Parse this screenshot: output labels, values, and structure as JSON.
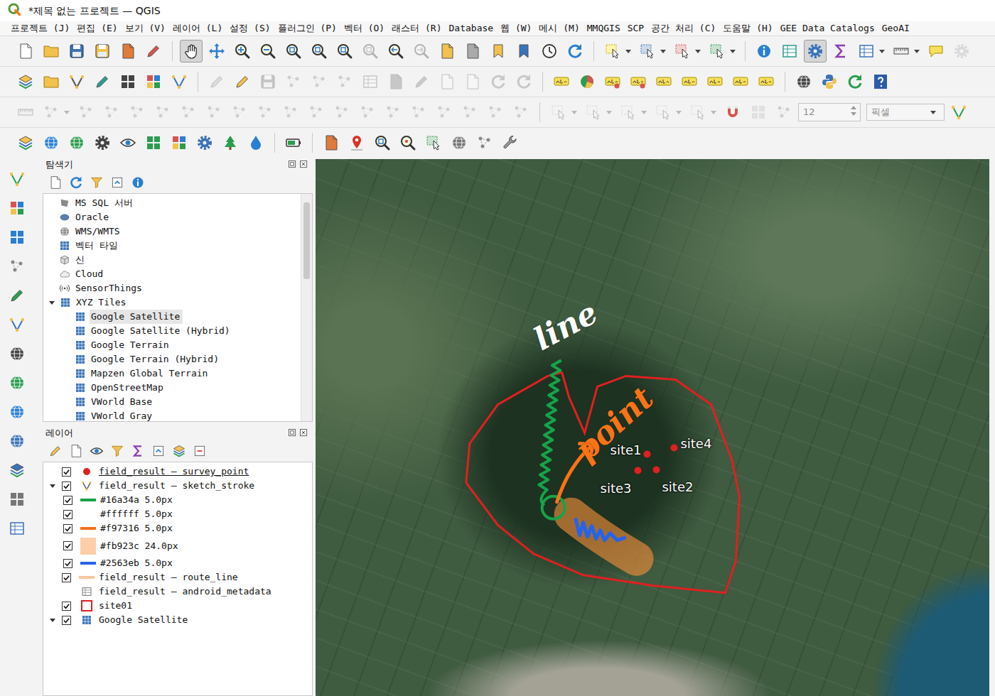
{
  "window": {
    "title": "*제목 없는 프로젝트 — QGIS"
  },
  "menu": [
    "프로젝트 (J)",
    "편집 (E)",
    "보기 (V)",
    "레이어 (L)",
    "설정 (S)",
    "플러그인 (P)",
    "벡터 (O)",
    "래스터 (R)",
    "Database",
    "웹 (W)",
    "메시 (M)",
    "MMQGIS",
    "SCP",
    "공간 처리 (C)",
    "도움말 (H)",
    "GEE Data Catalogs",
    "GeoAI"
  ],
  "toolbars": [
    {
      "tools": [
        {
          "selected": false,
          "disabled": false
        },
        {
          "selected": false,
          "disabled": false
        },
        {
          "selected": false,
          "disabled": false
        },
        {
          "selected": false,
          "disabled": false
        },
        {
          "selected": false,
          "disabled": false
        },
        {
          "selected": false,
          "disabled": false
        },
        {
          "selected": true,
          "disabled": false
        },
        {
          "selected": false,
          "disabled": false
        },
        {
          "selected": false,
          "disabled": false
        },
        {
          "selected": false,
          "disabled": false
        },
        {
          "selected": false,
          "disabled": false
        },
        {
          "selected": false,
          "disabled": false
        },
        {
          "selected": false,
          "disabled": false
        },
        {
          "selected": false,
          "disabled": true
        },
        {
          "selected": false,
          "disabled": false
        },
        {
          "selected": false,
          "disabled": true
        },
        {
          "selected": false,
          "disabled": false
        },
        {
          "selected": false,
          "disabled": false
        },
        {
          "selected": false,
          "disabled": false
        },
        {
          "selected": false,
          "disabled": false
        },
        {
          "selected": false,
          "disabled": false
        },
        {
          "selected": false,
          "disabled": false
        },
        {
          "selected": false,
          "disabled": false
        },
        {
          "selected": false,
          "disabled": false
        },
        {
          "selected": false,
          "disabled": false
        },
        {
          "selected": false,
          "disabled": false
        },
        {
          "selected": false,
          "disabled": false
        },
        {
          "selected": false,
          "disabled": false
        },
        {
          "selected": true,
          "disabled": false
        },
        {
          "selected": false,
          "disabled": false
        },
        {
          "selected": false,
          "disabled": false
        },
        {
          "selected": false,
          "disabled": false
        },
        {
          "selected": false,
          "disabled": false
        },
        {
          "selected": false,
          "disabled": true
        }
      ]
    },
    {
      "tools": [
        {
          "selected": false,
          "disabled": false
        },
        {
          "selected": false,
          "disabled": false
        },
        {
          "selected": false,
          "disabled": false
        },
        {
          "selected": false,
          "disabled": false
        },
        {
          "selected": false,
          "disabled": false
        },
        {
          "selected": false,
          "disabled": false
        },
        {
          "selected": false,
          "disabled": false
        },
        {
          "selected": false,
          "disabled": true
        },
        {
          "selected": false,
          "disabled": false
        },
        {
          "selected": false,
          "disabled": true
        },
        {
          "selected": false,
          "disabled": true
        },
        {
          "selected": false,
          "disabled": true
        },
        {
          "selected": false,
          "disabled": true
        },
        {
          "selected": false,
          "disabled": true
        },
        {
          "selected": false,
          "disabled": true
        },
        {
          "selected": false,
          "disabled": true
        },
        {
          "selected": false,
          "disabled": true
        },
        {
          "selected": false,
          "disabled": true
        },
        {
          "selected": false,
          "disabled": true
        },
        {
          "selected": false,
          "disabled": true
        },
        {
          "selected": false,
          "disabled": false
        },
        {
          "selected": false,
          "disabled": false
        },
        {
          "selected": false,
          "disabled": false
        },
        {
          "selected": false,
          "disabled": false
        },
        {
          "selected": false,
          "disabled": false
        },
        {
          "selected": false,
          "disabled": false
        },
        {
          "selected": false,
          "disabled": false
        },
        {
          "selected": false,
          "disabled": false
        },
        {
          "selected": false,
          "disabled": false
        },
        {
          "selected": false,
          "disabled": false
        },
        {
          "selected": false,
          "disabled": false
        },
        {
          "selected": false,
          "disabled": false
        },
        {
          "selected": false,
          "disabled": false
        }
      ]
    },
    {
      "tools": [
        {
          "selected": false,
          "disabled": true
        },
        {
          "selected": false,
          "disabled": true
        },
        {
          "selected": false,
          "disabled": true
        },
        {
          "selected": false,
          "disabled": true
        },
        {
          "selected": false,
          "disabled": true
        },
        {
          "selected": false,
          "disabled": true
        },
        {
          "selected": false,
          "disabled": true
        },
        {
          "selected": false,
          "disabled": true
        },
        {
          "selected": false,
          "disabled": true
        },
        {
          "selected": false,
          "disabled": true
        },
        {
          "selected": false,
          "disabled": true
        },
        {
          "selected": false,
          "disabled": true
        },
        {
          "selected": false,
          "disabled": true
        },
        {
          "selected": false,
          "disabled": true
        },
        {
          "selected": false,
          "disabled": true
        },
        {
          "selected": false,
          "disabled": true
        },
        {
          "selected": false,
          "disabled": true
        },
        {
          "selected": false,
          "disabled": true
        },
        {
          "selected": false,
          "disabled": true
        },
        {
          "selected": false,
          "disabled": true
        },
        {
          "selected": false,
          "disabled": true
        },
        {
          "selected": false,
          "disabled": true
        },
        {
          "selected": false,
          "disabled": true
        },
        {
          "selected": false,
          "disabled": true
        },
        {
          "selected": false,
          "disabled": true
        },
        {
          "selected": false,
          "disabled": false
        },
        {
          "selected": false,
          "disabled": true
        },
        {
          "selected": false,
          "disabled": true
        },
        {
          "selected": false,
          "disabled": false
        }
      ]
    },
    {
      "tools": [
        {
          "selected": false,
          "disabled": false
        },
        {
          "selected": false,
          "disabled": false
        },
        {
          "selected": false,
          "disabled": false
        },
        {
          "selected": false,
          "disabled": false
        },
        {
          "selected": false,
          "disabled": false
        },
        {
          "selected": false,
          "disabled": false
        },
        {
          "selected": false,
          "disabled": false
        },
        {
          "selected": false,
          "disabled": false
        },
        {
          "selected": false,
          "disabled": false
        },
        {
          "selected": false,
          "disabled": false
        },
        {
          "selected": false,
          "disabled": false
        },
        {
          "selected": false,
          "disabled": false
        },
        {
          "selected": false,
          "disabled": false
        },
        {
          "selected": false,
          "disabled": false
        },
        {
          "selected": false,
          "disabled": false
        },
        {
          "selected": false,
          "disabled": false
        },
        {
          "selected": false,
          "disabled": false
        },
        {
          "selected": false,
          "disabled": false
        },
        {
          "selected": false,
          "disabled": false
        }
      ]
    }
  ],
  "snapping": {
    "tolerance": "12",
    "unit": "픽셀"
  },
  "browser": {
    "title": "탐색기",
    "items": [
      {
        "label": "MS SQL 서버",
        "kind": "provider",
        "selected": false
      },
      {
        "label": "Oracle",
        "kind": "provider",
        "selected": false
      },
      {
        "label": "WMS/WMTS",
        "kind": "provider",
        "selected": false
      },
      {
        "label": "벡터 타일",
        "kind": "provider",
        "selected": false
      },
      {
        "label": "신",
        "kind": "provider",
        "selected": false
      },
      {
        "label": "Cloud",
        "kind": "provider",
        "selected": false
      },
      {
        "label": "SensorThings",
        "kind": "provider",
        "selected": false
      },
      {
        "label": "XYZ Tiles",
        "kind": "group",
        "expanded": true,
        "selected": false
      },
      {
        "label": "Google Satellite",
        "kind": "tile",
        "selected": true
      },
      {
        "label": "Google Satellite (Hybrid)",
        "kind": "tile",
        "selected": false
      },
      {
        "label": "Google Terrain",
        "kind": "tile",
        "selected": false
      },
      {
        "label": "Google Terrain (Hybrid)",
        "kind": "tile",
        "selected": false
      },
      {
        "label": "Mapzen Global Terrain",
        "kind": "tile",
        "selected": false
      },
      {
        "label": "OpenStreetMap",
        "kind": "tile",
        "selected": false
      },
      {
        "label": "VWorld Base",
        "kind": "tile",
        "selected": false
      },
      {
        "label": "VWorld Gray",
        "kind": "tile",
        "selected": false
      }
    ]
  },
  "layers_panel": {
    "title": "레이어",
    "layers": [
      {
        "label": "field_result – survey_point",
        "kind": "point",
        "checked": true,
        "selected": true,
        "color": "#e02020"
      },
      {
        "label": "field_result – sketch_stroke",
        "kind": "line-group",
        "checked": true,
        "expanded": true,
        "selected": false,
        "classes": [
          {
            "label": "#16a34a 5.0px",
            "kind": "line",
            "checked": true,
            "color": "#16a34a"
          },
          {
            "label": "#ffffff 5.0px",
            "kind": "line",
            "checked": true,
            "color": "#ffffff"
          },
          {
            "label": "#f97316 5.0px",
            "kind": "line",
            "checked": true,
            "color": "#f97316"
          },
          {
            "label": "#fb923c 24.0px",
            "kind": "area",
            "checked": true,
            "color": "#fb923c"
          },
          {
            "label": "#2563eb 5.0px",
            "kind": "line",
            "checked": true,
            "color": "#2563eb"
          }
        ]
      },
      {
        "label": "field_result – route_line",
        "kind": "line",
        "checked": true,
        "selected": false,
        "color": "#f5c89a"
      },
      {
        "label": "field_result – android_metadata",
        "kind": "table",
        "selected": false
      },
      {
        "label": "site01",
        "kind": "polygon",
        "checked": true,
        "selected": false,
        "color": "#e02020"
      },
      {
        "label": "Google Satellite",
        "kind": "raster",
        "checked": true,
        "expanded": true,
        "selected": false
      }
    ]
  },
  "map": {
    "annotations": [
      {
        "text": "line"
      },
      {
        "text": "point"
      }
    ],
    "sites": [
      {
        "label": "site1"
      },
      {
        "label": "site2"
      },
      {
        "label": "site3"
      },
      {
        "label": "site4"
      }
    ]
  }
}
